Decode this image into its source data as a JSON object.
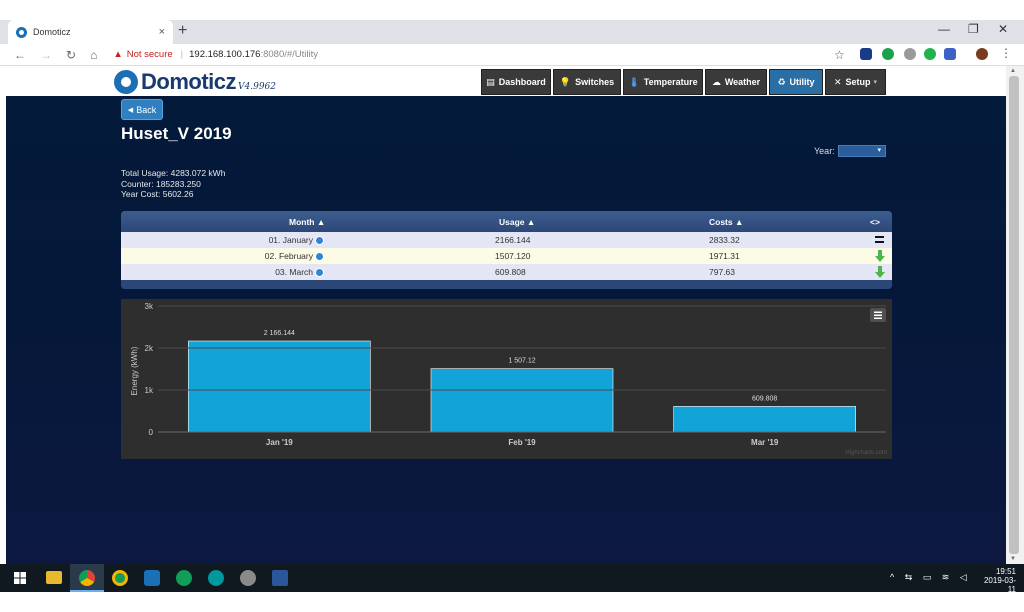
{
  "browser": {
    "tab_title": "Domoticz",
    "tab_close": "×",
    "new_tab": "+",
    "not_secure": "Not secure",
    "url_host": "192.168.100.176",
    "url_rest": ":8080/#/Utility",
    "win_min": "—",
    "win_max": "❐",
    "win_close": "✕"
  },
  "app": {
    "logo_text": "Domoticz",
    "logo_version": "V4.9962",
    "nav": [
      {
        "label": "Dashboard",
        "icon": "▤"
      },
      {
        "label": "Switches",
        "icon": "💡"
      },
      {
        "label": "Temperature",
        "icon": "🌡"
      },
      {
        "label": "Weather",
        "icon": "☁"
      },
      {
        "label": "Utility",
        "icon": "♻"
      },
      {
        "label": "Setup",
        "icon": "✕"
      }
    ],
    "setup_caret": "▾",
    "back_label": "Back",
    "title": "Huset_V 2019",
    "year_label": "Year:",
    "year_value": "▾",
    "stats": {
      "total_usage": "Total Usage: 4283.072 kWh",
      "counter": "Counter: 185283.250",
      "year_cost": "Year Cost: 5602.26"
    }
  },
  "table": {
    "headers": {
      "month": "Month ▲",
      "usage": "Usage ▲",
      "costs": "Costs ▲",
      "trend": "<>"
    },
    "rows": [
      {
        "month": "01. January",
        "usage": "2166.144",
        "costs": "2833.32",
        "trend": "equal"
      },
      {
        "month": "02. February",
        "usage": "1507.120",
        "costs": "1971.31",
        "trend": "down"
      },
      {
        "month": "03. March",
        "usage": "609.808",
        "costs": "797.63",
        "trend": "down"
      }
    ]
  },
  "chart_data": {
    "type": "bar",
    "categories": [
      "Jan '19",
      "Feb '19",
      "Mar '19"
    ],
    "values": [
      2166.144,
      1507.12,
      609.808
    ],
    "data_labels": [
      "2 166.144",
      "1 507.12",
      "609.808"
    ],
    "ylabel": "Energy (kWh)",
    "yticks": [
      "0",
      "1k",
      "2k",
      "3k"
    ],
    "ylim": [
      0,
      3000
    ],
    "grid": true,
    "bar_color": "#12a3d9",
    "credit": "Highcharts.com"
  },
  "taskbar": {
    "time": "19:51",
    "date": "2019-03-11"
  }
}
